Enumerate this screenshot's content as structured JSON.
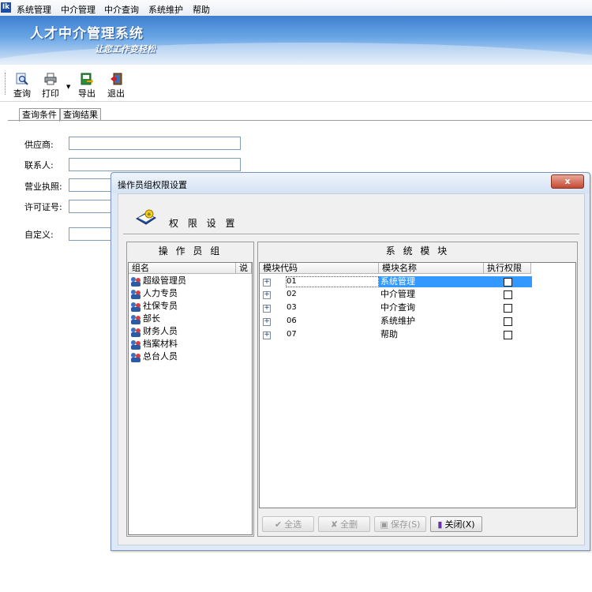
{
  "menubar": {
    "app_icon": "Ik",
    "items": [
      "系统管理",
      "中介管理",
      "中介查询",
      "系统维护",
      "帮助"
    ]
  },
  "banner": {
    "title": "人才中介管理系统",
    "slogan": "让您工作变轻松"
  },
  "toolbar": {
    "query": "查询",
    "print": "打印",
    "export": "导出",
    "exit": "退出"
  },
  "tabs": [
    "查询条件",
    "查询结果"
  ],
  "form": {
    "supplier_label": "供应商:",
    "contact_label": "联系人:",
    "license_label": "营业执照:",
    "permit_label": "许可证号:",
    "custom_label": "自定义:"
  },
  "dialog": {
    "title": "操作员组权限设置",
    "close": "x",
    "header": "权 限 设 置",
    "groups_panel": {
      "title": "操 作 员 组",
      "col_name": "组名",
      "col_desc": "说",
      "groups": [
        "超级管理员",
        "人力专员",
        "社保专员",
        "部长",
        "财务人员",
        "档案材料",
        "总台人员"
      ]
    },
    "modules_panel": {
      "title": "系 统 模 块",
      "col_code": "模块代码",
      "col_name": "模块名称",
      "col_perm": "执行权限",
      "rows": [
        {
          "code": "01",
          "name": "系统管理",
          "checked": false,
          "selected": true
        },
        {
          "code": "02",
          "name": "中介管理",
          "checked": false,
          "selected": false
        },
        {
          "code": "03",
          "name": "中介查询",
          "checked": false,
          "selected": false
        },
        {
          "code": "06",
          "name": "系统维护",
          "checked": false,
          "selected": false
        },
        {
          "code": "07",
          "name": "帮助",
          "checked": false,
          "selected": false
        }
      ]
    },
    "buttons": {
      "select_all": "全选",
      "clear_all": "全删",
      "save": "保存(S)",
      "close": "关闭(X)"
    }
  },
  "colors": {
    "banner_top": "#3e7fcf",
    "selection": "#3399ff",
    "close_button": "#c44a32"
  }
}
